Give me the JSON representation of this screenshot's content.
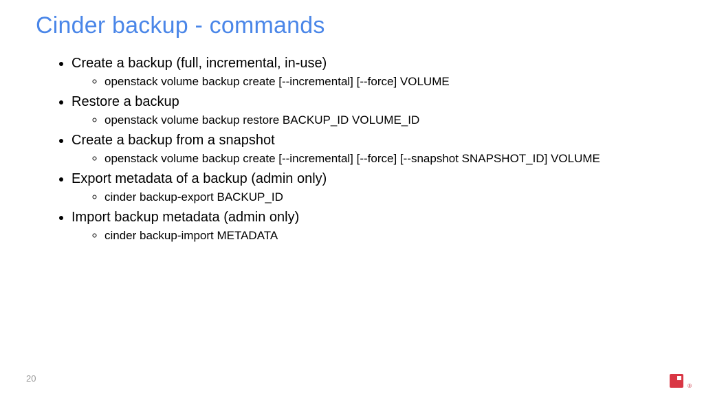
{
  "title": "Cinder backup - commands",
  "bullets": [
    {
      "text": "Create a backup (full, incremental, in-use)",
      "sub": [
        "openstack volume backup create [--incremental] [--force] VOLUME"
      ]
    },
    {
      "text": "Restore a backup",
      "sub": [
        "openstack volume backup restore BACKUP_ID VOLUME_ID"
      ]
    },
    {
      "text": "Create a backup from a snapshot",
      "sub": [
        "openstack volume backup create [--incremental] [--force] [--snapshot SNAPSHOT_ID] VOLUME"
      ]
    },
    {
      "text": "Export metadata of a backup (admin only)",
      "sub": [
        "cinder backup-export BACKUP_ID"
      ]
    },
    {
      "text": "Import backup metadata (admin only)",
      "sub": [
        "cinder backup-import METADATA"
      ]
    }
  ],
  "page_number": "20",
  "registered": "®"
}
